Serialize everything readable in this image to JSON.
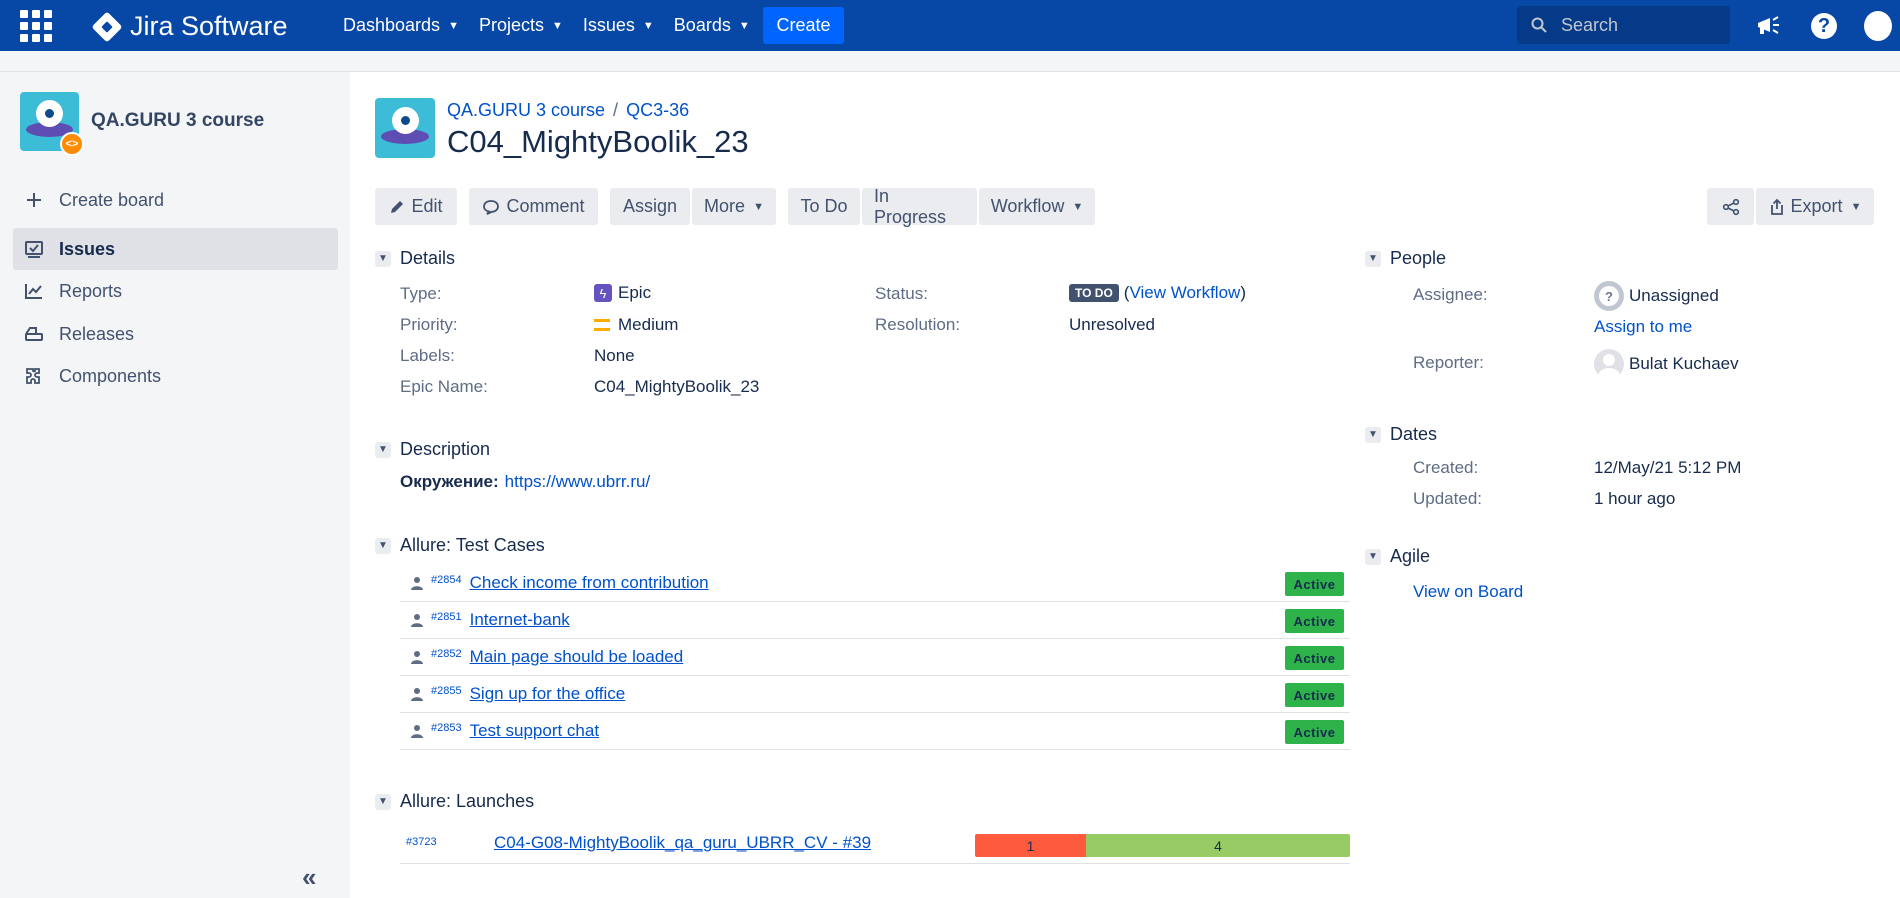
{
  "topbar": {
    "logo_text": "Jira Software",
    "nav": [
      "Dashboards",
      "Projects",
      "Issues",
      "Boards"
    ],
    "create_label": "Create",
    "search_placeholder": "Search",
    "help_label": "?"
  },
  "sidebar": {
    "project_name": "QA.GURU 3 course",
    "project_badge": "<>",
    "items": [
      {
        "label": "Create board",
        "icon": "plus-icon"
      },
      {
        "label": "Issues",
        "icon": "issues-icon"
      },
      {
        "label": "Reports",
        "icon": "reports-icon"
      },
      {
        "label": "Releases",
        "icon": "releases-icon"
      },
      {
        "label": "Components",
        "icon": "components-icon"
      }
    ],
    "collapse_label": "«"
  },
  "issue": {
    "breadcrumb_project": "QA.GURU 3 course",
    "breadcrumb_sep": "/",
    "breadcrumb_key": "QC3-36",
    "title": "C04_MightyBoolik_23"
  },
  "toolbar": {
    "edit": "Edit",
    "comment": "Comment",
    "assign": "Assign",
    "more": "More",
    "todo": "To Do",
    "in_progress": "In Progress",
    "workflow": "Workflow",
    "export": "Export"
  },
  "details": {
    "heading": "Details",
    "type_label": "Type:",
    "type_value": "Epic",
    "priority_label": "Priority:",
    "priority_value": "Medium",
    "labels_label": "Labels:",
    "labels_value": "None",
    "epic_name_label": "Epic Name:",
    "epic_name_value": "C04_MightyBoolik_23",
    "status_label": "Status:",
    "status_value": "TO DO",
    "view_workflow_open": "(",
    "view_workflow": "View Workflow",
    "view_workflow_close": ")",
    "resolution_label": "Resolution:",
    "resolution_value": "Unresolved"
  },
  "description": {
    "heading": "Description",
    "label": "Окружение:",
    "link": "https://www.ubrr.ru/"
  },
  "test_cases": {
    "heading": "Allure: Test Cases",
    "rows": [
      {
        "id": "#2854",
        "name": "Check income from contribution",
        "status": "Active"
      },
      {
        "id": "#2851",
        "name": "Internet-bank",
        "status": "Active"
      },
      {
        "id": "#2852",
        "name": "Main page should be loaded",
        "status": "Active"
      },
      {
        "id": "#2855",
        "name": "Sign up for the office",
        "status": "Active"
      },
      {
        "id": "#2853",
        "name": "Test support chat",
        "status": "Active"
      }
    ]
  },
  "launches": {
    "heading": "Allure: Launches",
    "rows": [
      {
        "id": "#3723",
        "name": "C04-G08-MightyBoolik_qa_guru_UBRR_CV - #39",
        "failed": "1",
        "passed": "4",
        "failed_count": 1,
        "passed_count": 4,
        "failed_color": "#fd5a3e",
        "passed_color": "#97cc64"
      }
    ]
  },
  "people": {
    "heading": "People",
    "assignee_label": "Assignee:",
    "assignee_value": "Unassigned",
    "assign_to_me": "Assign to me",
    "reporter_label": "Reporter:",
    "reporter_value": "Bulat Kuchaev"
  },
  "dates": {
    "heading": "Dates",
    "created_label": "Created:",
    "created_value": "12/May/21 5:12 PM",
    "updated_label": "Updated:",
    "updated_value": "1 hour ago"
  },
  "agile": {
    "heading": "Agile",
    "view_on_board": "View on Board"
  },
  "colors": {
    "brand_blue": "#0747a6",
    "create_blue": "#0065ff",
    "link": "#0052cc",
    "active_green": "#2db34a",
    "epic_purple": "#6554c0",
    "priority_orange": "#ffab00"
  }
}
